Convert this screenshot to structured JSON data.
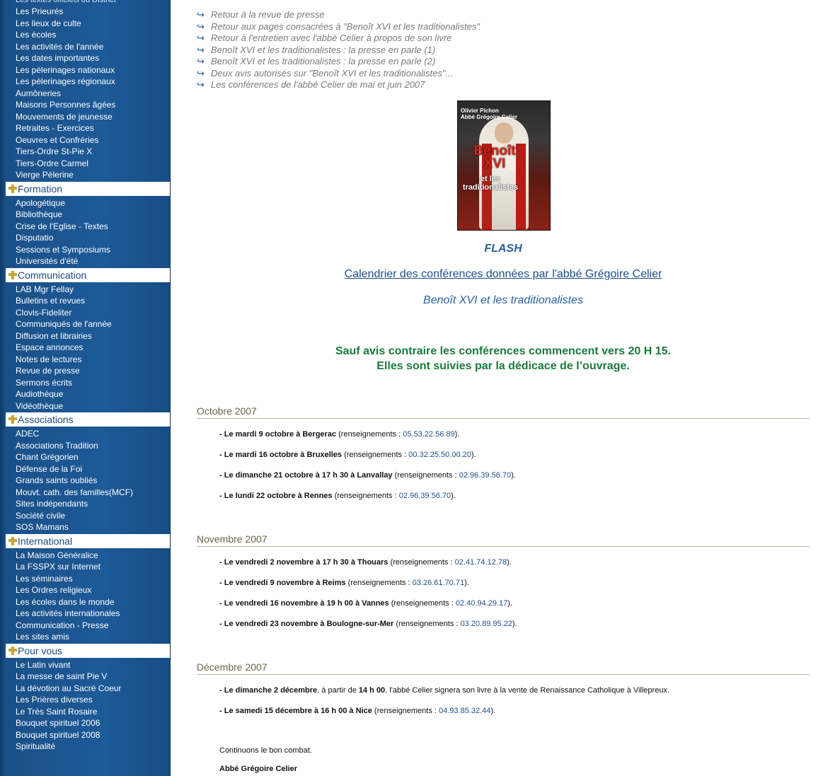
{
  "sidebar": {
    "cut_top": "Les textes officiels du District",
    "group_top": [
      "Les Prieurés",
      "Les lieux de culte",
      "Les écoles",
      "Les activités de l'année",
      "Les dates importantes",
      "Les pèlerinages nationaux",
      "Les pèlerinages régionaux",
      "Aumôneries",
      "Maisons Personnes âgées",
      "Mouvements de jeunesse",
      "Retraites - Exercices",
      "Oeuvres et Confréries",
      "Tiers-Ordre St-Pie X",
      "Tiers-Ordre Carmel",
      "Vierge Pèlerine"
    ],
    "sections": [
      {
        "title": "Formation",
        "items": [
          "Apologétique",
          "Bibliothèque",
          "Crise de l'Eglise - Textes",
          "Disputatio",
          "Sessions et Symposiums",
          "Universités d'été"
        ]
      },
      {
        "title": "Communication",
        "items": [
          "LAB Mgr Fellay",
          "Bulletins et revues",
          "Clovis-Fideliter",
          "Communiqués de l'année",
          "Diffusion et librairies",
          "Espace annonces",
          "Notes de lectures",
          "Revue de presse",
          "Sermons écrits",
          "Audiothèque",
          "Vidéothèque"
        ]
      },
      {
        "title": "Associations",
        "items": [
          "ADEC",
          "Associations Tradition",
          "Chant Grégorien",
          "Défense de la Foi",
          "Grands saints oubliés",
          "Mouvt. cath. des familles(MCF)",
          "Sites indépendants",
          "Société civile",
          "SOS Mamans"
        ]
      },
      {
        "title": "International",
        "items": [
          "La Maison Généralice",
          "La FSSPX sur Internet",
          "Les séminaires",
          "Les Ordres religieux",
          "Les écoles dans le monde",
          "Les activités internationales",
          "Communication - Presse",
          "Les sites amis"
        ]
      },
      {
        "title": "Pour vous",
        "items": [
          "Le Latin vivant",
          "La messe de saint Pie V",
          "La dévotion au Sacré Coeur",
          "Les Prières diverses",
          "Le Très Saint Rosaire",
          "Bouquet spirituel 2006",
          "Bouquet spirituel 2008",
          "Spiritualité"
        ]
      }
    ]
  },
  "main": {
    "back_links": [
      "Retour à la revue de presse",
      "Retour aux pages consacrées à \"Benoît XVI et les traditionalistes\"",
      "Retour à l'entretien avec l'abbé Celier à propos de son livre",
      "Benoît XVI et les traditionalistes : la presse en parle (1)",
      "Benoît XVI et les traditionalistes : la presse en parle (2)",
      "Deux avis autorisés sur \"Benoît XVI et les traditionalistes\"...",
      "Les conférences de l'abbé Celier de mai et juin 2007"
    ],
    "book": {
      "author1": "Olivier Pichon",
      "author2": "Abbé Grégoire Celier",
      "title_main": "Benoît XVI",
      "title_sub": "et les traditionalistes"
    },
    "flash": "FLASH",
    "calendar_link": "Calendrier des conférences données par l'abbé Grégoire Celier",
    "subtitle": "Benoît XVI et les traditionalistes",
    "notice_line1": "Sauf avis contraire les conférences commencent vers 20 H 15.",
    "notice_line2": "Elles sont suivies par la dédicace de l’ouvrage.",
    "months": [
      {
        "name": "Octobre 2007",
        "events": [
          {
            "who": "- Le mardi 9 octobre à Bergerac",
            "pre": " (renseignements : ",
            "phone": "05.53.22.56.89",
            "post": ")."
          },
          {
            "who": "- Le mardi 16 octobre à Bruxelles",
            "pre": " (renseignements : ",
            "phone": "00.32.25.50.00.20",
            "post": ")."
          },
          {
            "who": "- Le dimanche 21 octobre à 17 h 30 à Lanvallay",
            "pre": " (renseignements : ",
            "phone": "02.96.39.56.70",
            "post": ")."
          },
          {
            "who": "- Le lundi 22 octobre à Rennes",
            "pre": " (renseignements : ",
            "phone": "02.96.39.56.70",
            "post": ")."
          }
        ]
      },
      {
        "name": "Novembre 2007",
        "events": [
          {
            "who": "- Le vendredi 2 novembre à 17 h 30 à Thouars",
            "pre": " (renseignements : ",
            "phone": "02.41.74.12.78",
            "post": ")."
          },
          {
            "who": "- Le vendredi 9 novembre à Reims",
            "pre": " (renseignements : ",
            "phone": "03.26.61.70.71",
            "post": ")."
          },
          {
            "who": "- Le vendredi 16 novembre à 19 h 00 à Vannes",
            "pre": " (renseignements : ",
            "phone": "02.40.94.29.17",
            "post": ")."
          },
          {
            "who": "- Le vendredi 23 novembre à Boulogne-sur-Mer",
            "pre": " (renseignements : ",
            "phone": "03.20.89.95.22",
            "post": ")."
          }
        ]
      },
      {
        "name": "Décembre 2007",
        "events": [
          {
            "who": "- Le dimanche 2 décembre",
            "pre": ", à partir de ",
            "bold2": "14 h 00",
            "tail": ", l'abbé Celier signera son livre à la vente de Renaissance Catholique à Villepreux."
          },
          {
            "who": "- Le samedi 15 décembre à 16 h 00 à Nice",
            "pre": " (renseignements : ",
            "phone": "04.93.85.32.44",
            "post": ")."
          }
        ]
      }
    ],
    "closing": "Continuons le bon combat.",
    "signature": "Abbé Grégoire Celier"
  },
  "colors": {
    "sidebar_bg": "#1d5a98",
    "section_head_text": "#1a4a85",
    "cross": "#c8a43a",
    "link_blue": "#1d4e8d",
    "notice_green": "#1a7a3c",
    "month_olive": "#6b6346"
  },
  "icons": {
    "section": "cross-icon",
    "back_link": "arrow-icon"
  }
}
